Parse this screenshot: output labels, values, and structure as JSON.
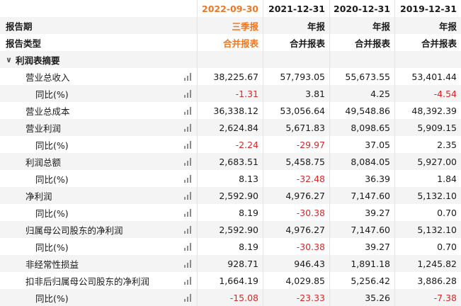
{
  "header": {
    "period_label": "报告期",
    "type_label": "报告类型",
    "columns": [
      {
        "date": "2022-09-30",
        "period": "三季报",
        "type": "合并报表"
      },
      {
        "date": "2021-12-31",
        "period": "年报",
        "type": "合并报表"
      },
      {
        "date": "2020-12-31",
        "period": "年报",
        "type": "合并报表"
      },
      {
        "date": "2019-12-31",
        "period": "年报",
        "type": "合并报表"
      }
    ]
  },
  "section": {
    "title": "利润表摘要"
  },
  "rows": [
    {
      "label": "营业总收入",
      "values": [
        "38,225.67",
        "57,793.05",
        "55,673.55",
        "53,401.44"
      ]
    },
    {
      "label": "同比(%)",
      "values": [
        "-1.31",
        "3.81",
        "4.25",
        "-4.54"
      ]
    },
    {
      "label": "营业总成本",
      "values": [
        "36,338.12",
        "53,056.64",
        "49,548.86",
        "48,392.39"
      ]
    },
    {
      "label": "营业利润",
      "values": [
        "2,624.84",
        "5,671.83",
        "8,098.65",
        "5,909.15"
      ]
    },
    {
      "label": "同比(%)",
      "values": [
        "-2.24",
        "-29.97",
        "37.05",
        "2.35"
      ]
    },
    {
      "label": "利润总额",
      "values": [
        "2,683.51",
        "5,458.75",
        "8,084.05",
        "5,927.00"
      ]
    },
    {
      "label": "同比(%)",
      "values": [
        "8.13",
        "-32.48",
        "36.39",
        "1.84"
      ]
    },
    {
      "label": "净利润",
      "values": [
        "2,592.90",
        "4,976.27",
        "7,147.60",
        "5,132.10"
      ]
    },
    {
      "label": "同比(%)",
      "values": [
        "8.19",
        "-30.38",
        "39.27",
        "0.70"
      ]
    },
    {
      "label": "归属母公司股东的净利润",
      "values": [
        "2,592.90",
        "4,976.27",
        "7,147.60",
        "5,132.10"
      ]
    },
    {
      "label": "同比(%)",
      "values": [
        "8.19",
        "-30.38",
        "39.27",
        "0.70"
      ]
    },
    {
      "label": "非经常性损益",
      "values": [
        "928.71",
        "946.43",
        "1,891.18",
        "1,245.82"
      ]
    },
    {
      "label": "扣非后归属母公司股东的净利润",
      "values": [
        "1,664.19",
        "4,029.85",
        "5,256.42",
        "3,886.28"
      ]
    },
    {
      "label": "同比(%)",
      "values": [
        "-15.08",
        "-23.33",
        "35.26",
        "-7.38"
      ]
    }
  ],
  "icons": {
    "chart": "bar-chart-icon",
    "collapse": "chevron-down-icon"
  },
  "colors": {
    "accent": "#ee7722",
    "negative": "#d42a2a",
    "zebra": "#f4f4f4"
  }
}
